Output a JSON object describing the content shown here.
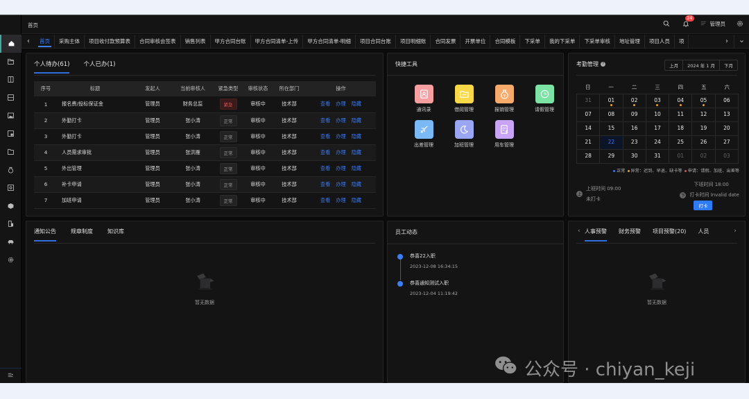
{
  "header": {
    "breadcrumb": "首页",
    "notification_count": "24",
    "user_name": "管理员"
  },
  "tabs": [
    "首页",
    "采购主体",
    "项目收付款预算表",
    "合同审核会签表",
    "销售列表",
    "甲方合同台账",
    "甲方合同清单-上传",
    "甲方合同清单-明细",
    "项目合同台账",
    "项目明细账",
    "合同发票",
    "开票单位",
    "合同模板",
    "下采单",
    "我的下采单",
    "下采单审核",
    "地址管理",
    "项目人员",
    "项"
  ],
  "sidebar": {
    "items": [
      "home",
      "folder",
      "book",
      "list",
      "image",
      "report",
      "file",
      "moneybag",
      "disk",
      "box",
      "building",
      "car",
      "gear"
    ]
  },
  "todo": {
    "tabs": [
      "个人待办(61)",
      "个人已办(1)"
    ],
    "columns": [
      "序号",
      "标题",
      "发起人",
      "当前审核人",
      "紧急类型",
      "审核状态",
      "所在部门",
      "操作"
    ],
    "actions": [
      "查看",
      "办理",
      "隐藏"
    ],
    "rows": [
      {
        "no": "1",
        "title": "报名费/投标保证金",
        "initiator": "管理员",
        "reviewer": "财务总监",
        "urgency": "紧急",
        "urgent": true,
        "status": "审核中",
        "dept": "技术部"
      },
      {
        "no": "2",
        "title": "外勤打卡",
        "initiator": "管理员",
        "reviewer": "张小涛",
        "urgency": "正常",
        "urgent": false,
        "status": "审核中",
        "dept": "技术部"
      },
      {
        "no": "3",
        "title": "外勤打卡",
        "initiator": "管理员",
        "reviewer": "张小涛",
        "urgency": "正常",
        "urgent": false,
        "status": "审核中",
        "dept": "技术部"
      },
      {
        "no": "4",
        "title": "人员需求审批",
        "initiator": "管理员",
        "reviewer": "张洪雁",
        "urgency": "正常",
        "urgent": false,
        "status": "审核中",
        "dept": "技术部"
      },
      {
        "no": "5",
        "title": "外出管理",
        "initiator": "管理员",
        "reviewer": "张小涛",
        "urgency": "正常",
        "urgent": false,
        "status": "审核中",
        "dept": "技术部"
      },
      {
        "no": "6",
        "title": "补卡申请",
        "initiator": "管理员",
        "reviewer": "张小涛",
        "urgency": "正常",
        "urgent": false,
        "status": "审核中",
        "dept": "技术部"
      },
      {
        "no": "7",
        "title": "加班申请",
        "initiator": "管理员",
        "reviewer": "张小涛",
        "urgency": "正常",
        "urgent": false,
        "status": "审核中",
        "dept": "技术部"
      }
    ]
  },
  "quick_tools": {
    "title": "快捷工具",
    "items": [
      {
        "label": "通讯录",
        "icon": "contacts-icon",
        "color": "#f79ea0"
      },
      {
        "label": "借阅管理",
        "icon": "folder-icon",
        "color": "#fad848"
      },
      {
        "label": "报销管理",
        "icon": "moneybag-icon",
        "color": "#f7aa6a"
      },
      {
        "label": "请假管理",
        "icon": "clock-icon",
        "color": "#7be3a4"
      },
      {
        "label": "出差管理",
        "icon": "plane-icon",
        "color": "#7ab8f6"
      },
      {
        "label": "加班管理",
        "icon": "moon-icon",
        "color": "#9aa6f4"
      },
      {
        "label": "用车管理",
        "icon": "document-icon",
        "color": "#c9a4f5"
      }
    ]
  },
  "attendance": {
    "title": "考勤管理",
    "prev": "上月",
    "month": "2024 年 1 月",
    "next": "下月",
    "weekdays": [
      "日",
      "一",
      "二",
      "三",
      "四",
      "五",
      "六"
    ],
    "days": [
      {
        "d": "31",
        "muted": true
      },
      {
        "d": "01",
        "dot": true
      },
      {
        "d": "02",
        "dot": true
      },
      {
        "d": "03",
        "dot": true
      },
      {
        "d": "04",
        "dot": true
      },
      {
        "d": "05",
        "dot": true
      },
      {
        "d": "06"
      },
      {
        "d": "07"
      },
      {
        "d": "08"
      },
      {
        "d": "09"
      },
      {
        "d": "10"
      },
      {
        "d": "11"
      },
      {
        "d": "12"
      },
      {
        "d": "13"
      },
      {
        "d": "14"
      },
      {
        "d": "15"
      },
      {
        "d": "16"
      },
      {
        "d": "17"
      },
      {
        "d": "18"
      },
      {
        "d": "19"
      },
      {
        "d": "20"
      },
      {
        "d": "21"
      },
      {
        "d": "22",
        "today": true
      },
      {
        "d": "23"
      },
      {
        "d": "24"
      },
      {
        "d": "25"
      },
      {
        "d": "26"
      },
      {
        "d": "27"
      },
      {
        "d": "28"
      },
      {
        "d": "29"
      },
      {
        "d": "30"
      },
      {
        "d": "31"
      },
      {
        "d": "01",
        "muted": true
      },
      {
        "d": "02",
        "muted": true
      },
      {
        "d": "03",
        "muted": true
      }
    ],
    "legend": [
      {
        "label": "正常",
        "color": "#3a78f0"
      },
      {
        "label": "异常：迟到、早退、缺卡等",
        "color": "#f0a020"
      },
      {
        "label": "申请：请假、加班、出差等",
        "color": "#e05050"
      }
    ],
    "start_icon": "上",
    "start_time": "上班时间 09:00",
    "start_status": "未打卡",
    "end_icon": "下",
    "end_time": "下班时间 18:00",
    "punch_time": "打卡时间 Invalid date",
    "punch_button": "打卡"
  },
  "notices": {
    "tabs": [
      "通知公告",
      "规章制度",
      "知识库"
    ],
    "empty": "暂无数据"
  },
  "staff_dynamics": {
    "title": "员工动态",
    "items": [
      {
        "title": "恭喜22入职",
        "time": "2023-12-08 16:34:15"
      },
      {
        "title": "恭喜通知测试入职",
        "time": "2023-12-04 11:19:42"
      }
    ]
  },
  "warnings": {
    "tabs": [
      "人事预警",
      "财务预警",
      "项目预警(20)",
      "人员"
    ],
    "empty": "暂无数据"
  },
  "watermark": "公众号 · chiyan_keji"
}
